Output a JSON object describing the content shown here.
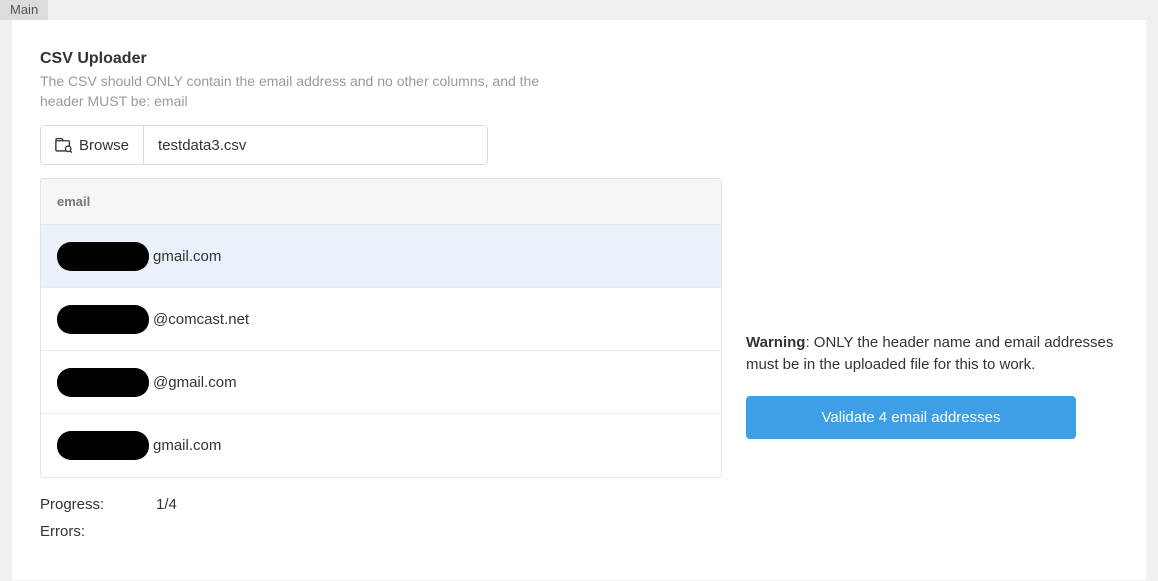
{
  "tab": {
    "label": "Main"
  },
  "uploader": {
    "title": "CSV Uploader",
    "description": "The CSV should ONLY contain the email address and no other columns, and the header MUST be: email",
    "browse_label": "Browse",
    "file_name": "testdata3.csv"
  },
  "table": {
    "header": "email",
    "rows": [
      {
        "redacted_prefix": true,
        "visible_tail": "gmail.com",
        "selected": true
      },
      {
        "redacted_prefix": true,
        "visible_tail": "@comcast.net",
        "selected": false
      },
      {
        "redacted_prefix": true,
        "visible_tail": "@gmail.com",
        "selected": false
      },
      {
        "redacted_prefix": true,
        "visible_tail": "gmail.com",
        "selected": false
      }
    ]
  },
  "progress": {
    "label": "Progress:",
    "value": "1/4"
  },
  "errors": {
    "label": "Errors:",
    "value": ""
  },
  "warning": {
    "strong": "Warning",
    "text": ": ONLY the header name and email addresses must be in the uploaded file for this to work."
  },
  "validate": {
    "label": "Validate 4 email addresses"
  }
}
